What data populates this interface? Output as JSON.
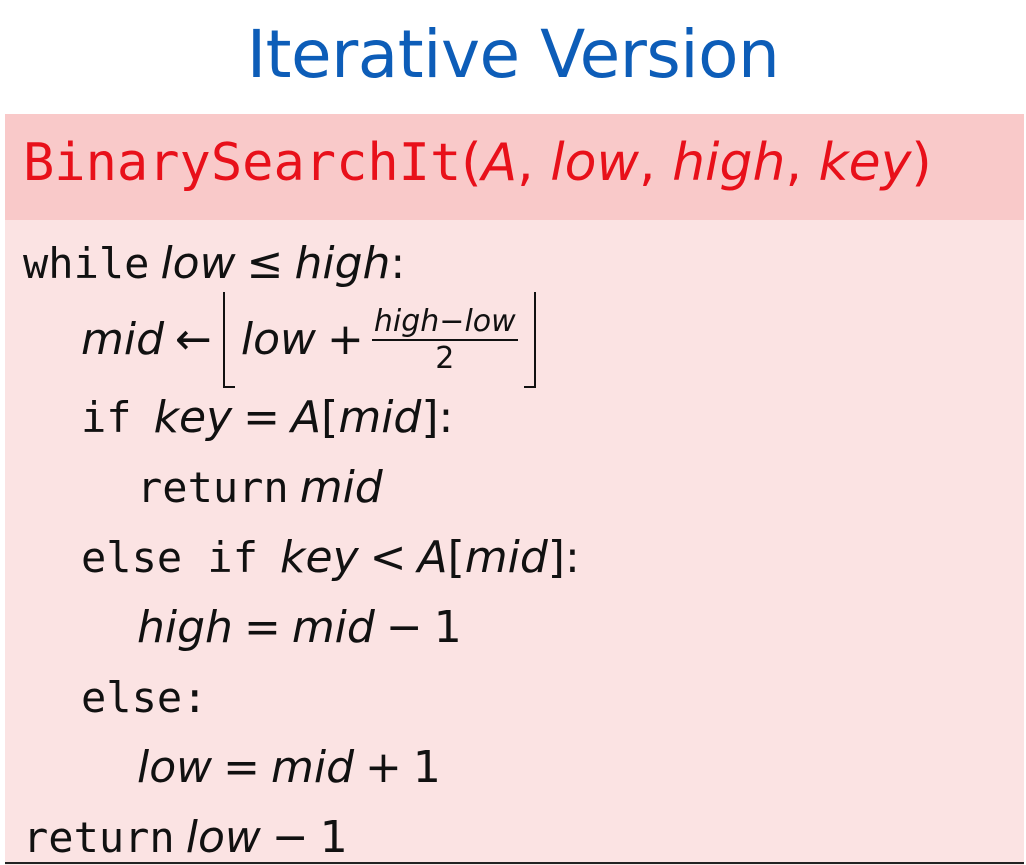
{
  "slide": {
    "title": "Iterative Version",
    "function": {
      "name": "BinarySearchIt",
      "open_paren": "(",
      "params": [
        "A",
        "low",
        "high",
        "key"
      ],
      "close_paren": ")",
      "separator": ", "
    },
    "code": {
      "line1": {
        "kw": "while",
        "lhs": "low",
        "op": "≤",
        "rhs": "high",
        "colon": ":"
      },
      "line2": {
        "lhs": "mid",
        "arrow": "←",
        "low": "low",
        "plus": "+",
        "frac_num": "high−low",
        "frac_den": "2"
      },
      "line3": {
        "kw": "if",
        "lhs": "key",
        "op": "=",
        "arr": "A",
        "lbr": "[",
        "idx": "mid",
        "rbr": "]",
        "colon": ":"
      },
      "line4": {
        "kw": "return",
        "val": "mid"
      },
      "line5": {
        "kw": "else if",
        "lhs": "key",
        "op": "<",
        "arr": "A",
        "lbr": "[",
        "idx": "mid",
        "rbr": "]",
        "colon": ":"
      },
      "line6": {
        "lhs": "high",
        "op": "=",
        "a": "mid",
        "minus": "−",
        "b": "1"
      },
      "line7": {
        "kw": "else:"
      },
      "line8": {
        "lhs": "low",
        "op": "=",
        "a": "mid",
        "plus": "+",
        "b": "1"
      },
      "line9": {
        "kw": "return",
        "a": "low",
        "minus": "−",
        "b": "1"
      }
    }
  },
  "colors": {
    "title": "#0d5db8",
    "header_bg": "#f9c9c9",
    "body_bg": "#fbe3e3",
    "function_text": "#e8101a"
  }
}
